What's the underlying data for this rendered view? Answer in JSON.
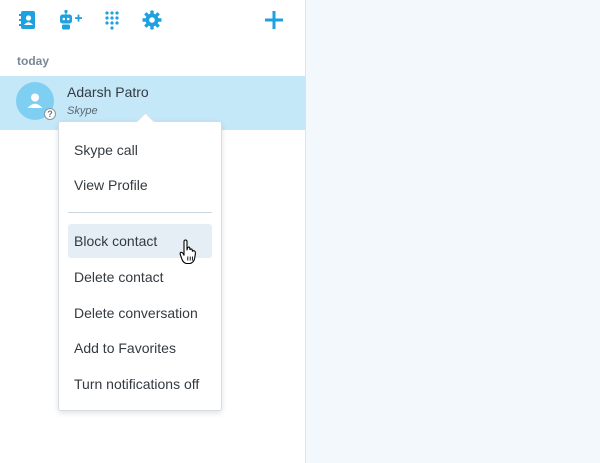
{
  "toolbar": {
    "icons": [
      "contacts-book-icon",
      "add-bot-icon",
      "dialpad-icon",
      "gear-icon",
      "plus-icon"
    ],
    "accent": "#1da1e0"
  },
  "recent": {
    "section_label": "today",
    "conversation": {
      "name": "Adarsh Patro",
      "subtitle": "Skype",
      "presence_symbol": "?"
    }
  },
  "context_menu": {
    "items": [
      {
        "label": "Skype call"
      },
      {
        "label": "View Profile"
      },
      {
        "label": "Block contact",
        "hovered": true
      },
      {
        "label": "Delete contact"
      },
      {
        "label": "Delete conversation"
      },
      {
        "label": "Add to Favorites"
      },
      {
        "label": "Turn notifications off"
      }
    ]
  },
  "colors": {
    "selected_row": "#c5e8f8",
    "main_background": "#f3f8fc",
    "menu_hover": "#e5eef4"
  }
}
